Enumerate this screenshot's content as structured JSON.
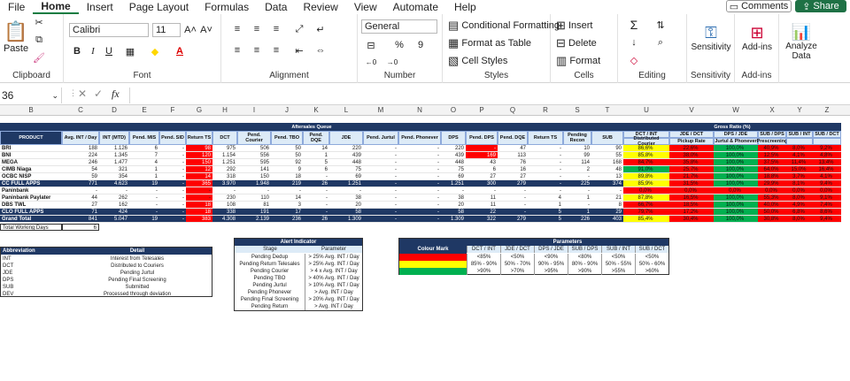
{
  "menu": [
    "File",
    "Home",
    "Insert",
    "Page Layout",
    "Formulas",
    "Data",
    "Review",
    "View",
    "Automate",
    "Help"
  ],
  "active_menu": "Home",
  "comments": "Comments",
  "share": "Share",
  "ribbon": {
    "clipboard": "Clipboard",
    "paste": "Paste",
    "font_group": "Font",
    "font_name": "Calibri",
    "font_size": "11",
    "alignment": "Alignment",
    "number": "Number",
    "number_format": "General",
    "styles": "Styles",
    "conditional": "Conditional Formatting",
    "format_table": "Format as Table",
    "cell_styles": "Cell Styles",
    "cells": "Cells",
    "insert": "Insert",
    "delete": "Delete",
    "format": "Format",
    "editing": "Editing",
    "sensitivity": "Sensitivity",
    "addins": "Add-ins",
    "addins_label": "Add-ins",
    "analyze": "Analyze Data"
  },
  "namebox": "36",
  "fx": "fx",
  "columns": [
    "B",
    "C",
    "D",
    "E",
    "F",
    "G",
    "H",
    "I",
    "J",
    "K",
    "L",
    "M",
    "N",
    "O",
    "P",
    "Q",
    "R",
    "S",
    "T",
    "U",
    "V",
    "W",
    "X",
    "Y",
    "Z"
  ],
  "queue_title": "Aftersales Queue",
  "gross_title": "Gross Ratio (%)",
  "product": "PRODUCT",
  "headers": [
    "Avg. INT / Day",
    "INT (MTD)",
    "Pend. MIS",
    "Pend. SID",
    "Return TS",
    "DCT",
    "Pend. Courier",
    "Pend. TBO",
    "Pend. DQE",
    "JDE",
    "Pend. Jurtul",
    "Pend. Phonever",
    "DPS",
    "Pend. DPS",
    "Pend. DQE",
    "Return TS",
    "Pending Recon",
    "SUB"
  ],
  "ratio_headers_top": [
    "DCT / INT",
    "JDE / DCT",
    "DPS / JDE",
    "SUB / DPS",
    "SUB / INT",
    "SUB / DCT"
  ],
  "ratio_headers_sub": [
    "Distributed Courier",
    "Pickup Rate",
    "Jurtul & Phonever",
    "Prescreening",
    "",
    ""
  ],
  "rows": [
    {
      "name": "BRI",
      "vals": [
        "188",
        "1.126",
        "6",
        "-",
        "98",
        "975",
        "506",
        "50",
        "14",
        "220",
        "-",
        "-",
        "220",
        "-",
        "47",
        "-",
        "10",
        "90"
      ],
      "ratios": [
        "86,6%",
        "22,6%",
        "100,0%",
        "40,9%",
        "8,0%",
        "9,2%"
      ]
    },
    {
      "name": "BNI",
      "vals": [
        "224",
        "1.345",
        "7",
        "-",
        "120",
        "1.154",
        "556",
        "50",
        "1",
        "439",
        "-",
        "-",
        "439",
        "169",
        "113",
        "-",
        "99",
        "55"
      ],
      "ratios": [
        "85,8%",
        "38,0%",
        "100,0%",
        "12,5%",
        "4,1%",
        "4,8%"
      ]
    },
    {
      "name": "MEGA",
      "vals": [
        "246",
        "1.477",
        "4",
        "-",
        "150",
        "1.251",
        "595",
        "92",
        "5",
        "448",
        "-",
        "-",
        "448",
        "43",
        "76",
        "-",
        "114",
        "168"
      ],
      "ratios": [
        "84,7%",
        "35,8%",
        "100,0%",
        "37,5%",
        "11,4%",
        "13,4%"
      ]
    },
    {
      "name": "CIMB Niaga",
      "vals": [
        "54",
        "321",
        "1",
        "-",
        "12",
        "292",
        "141",
        "9",
        "6",
        "75",
        "-",
        "-",
        "75",
        "6",
        "16",
        "-",
        "2",
        "48"
      ],
      "ratios": [
        "91,0%",
        "25,7%",
        "100,0%",
        "64,0%",
        "15,0%",
        "16,4%"
      ]
    },
    {
      "name": "OCBC NISP",
      "vals": [
        "59",
        "354",
        "1",
        "-",
        "14",
        "318",
        "150",
        "18",
        "-",
        "69",
        "-",
        "-",
        "69",
        "27",
        "27",
        "-",
        "-",
        "13"
      ],
      "ratios": [
        "89,8%",
        "21,7%",
        "100,0%",
        "18,8%",
        "3,7%",
        "4,1%"
      ]
    },
    {
      "name": "CC FULL APPS",
      "vals": [
        "771",
        "4.623",
        "19",
        "-",
        "365",
        "3.970",
        "1.948",
        "219",
        "26",
        "1.251",
        "-",
        "-",
        "1.251",
        "300",
        "279",
        "-",
        "225",
        "374"
      ],
      "ratios": [
        "85,9%",
        "31,5%",
        "100,0%",
        "29,9%",
        "8,1%",
        "9,4%"
      ]
    },
    {
      "name": "Paninbank",
      "vals": [
        "-",
        "-",
        "-",
        "-",
        "-",
        "-",
        "-",
        "-",
        "-",
        "-",
        "-",
        "-",
        "-",
        "-",
        "-",
        "-",
        "-",
        "-"
      ],
      "ratios": [
        "0,0%",
        "0,0%",
        "0,0%",
        "0,0%",
        "0,0%",
        "0,0%"
      ]
    },
    {
      "name": "Paninbank Paylater",
      "vals": [
        "44",
        "262",
        "-",
        "-",
        "-",
        "230",
        "110",
        "14",
        "-",
        "38",
        "-",
        "-",
        "38",
        "11",
        "-",
        "4",
        "1",
        "21"
      ],
      "ratios": [
        "87,8%",
        "16,5%",
        "100,0%",
        "55,3%",
        "8,0%",
        "9,1%"
      ]
    },
    {
      "name": "DBS TWL",
      "vals": [
        "27",
        "162",
        "-",
        "-",
        "18",
        "108",
        "81",
        "3",
        "-",
        "20",
        "-",
        "-",
        "20",
        "11",
        "-",
        "1",
        "-",
        "8"
      ],
      "ratios": [
        "66,7%",
        "18,5%",
        "100,0%",
        "40,0%",
        "4,9%",
        "7,4%"
      ]
    },
    {
      "name": "CLO FULL APPS",
      "vals": [
        "71",
        "424",
        "-",
        "-",
        "18",
        "338",
        "191",
        "17",
        "-",
        "58",
        "-",
        "-",
        "58",
        "22",
        "-",
        "5",
        "1",
        "29"
      ],
      "ratios": [
        "79,7%",
        "17,2%",
        "100,0%",
        "50,0%",
        "6,8%",
        "8,6%"
      ]
    },
    {
      "name": "Grand Total",
      "vals": [
        "841",
        "5.047",
        "19",
        "-",
        "383",
        "4.308",
        "2.139",
        "236",
        "26",
        "1.309",
        "-",
        "-",
        "1.309",
        "322",
        "279",
        "5",
        "226",
        "403"
      ],
      "ratios": [
        "85,4%",
        "30,4%",
        "100,0%",
        "30,8%",
        "8,0%",
        "9,4%"
      ]
    }
  ],
  "total_working_days": {
    "label": "Total Working Days",
    "value": "6"
  },
  "abbr": {
    "title_a": "Abbreviation",
    "title_b": "Detail",
    "items": [
      [
        "INT",
        "Interest from Telesales"
      ],
      [
        "DCT",
        "Distributed to Couriers"
      ],
      [
        "JDE",
        "Pending Jurtul"
      ],
      [
        "DPS",
        "Pending Final Screening"
      ],
      [
        "SUB",
        "Submitted"
      ],
      [
        "DEV",
        "Processed through deviation"
      ]
    ]
  },
  "alert": {
    "title": "Alert Indicator",
    "col_a": "Stage",
    "col_b": "Parameter",
    "items": [
      [
        "Pending Dedup",
        "> 25% Avg. INT / Day"
      ],
      [
        "Pending Return Telesales",
        "> 25% Avg. INT / Day"
      ],
      [
        "Pending Courier",
        "> 4 x Avg. INT / Day"
      ],
      [
        "Pending TBO",
        "> 40% Avg. INT / Day"
      ],
      [
        "Pending Jurtul",
        "> 10% Avg. INT / Day"
      ],
      [
        "Pending Phonever",
        "> Avg. INT / Day"
      ],
      [
        "Pending Final Screening",
        "> 20% Avg. INT / Day"
      ],
      [
        "Pending Return",
        "> Avg. INT / Day"
      ]
    ]
  },
  "params": {
    "title": "Parameters",
    "mark": "Colour Mark",
    "cols": [
      "DCT / INT",
      "JDE / DCT",
      "DPS / JDE",
      "SUB / DPS",
      "SUB / INT",
      "SUB / DCT"
    ],
    "rows": [
      [
        "<85%",
        "<50%",
        "<90%",
        "<80%",
        "<50%",
        "<50%"
      ],
      [
        "85% - 90%",
        "50% - 70%",
        "90% - 95%",
        "80% - 90%",
        "50% - 55%",
        "50% - 60%"
      ],
      [
        ">90%",
        ">70%",
        ">95%",
        ">90%",
        ">55%",
        ">60%"
      ]
    ],
    "colors": [
      "#ff0000",
      "#ffff00",
      "#00b050"
    ]
  }
}
